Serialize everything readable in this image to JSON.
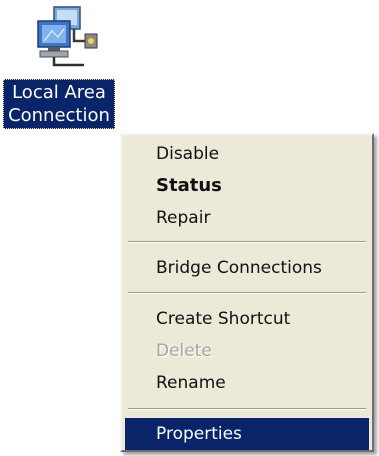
{
  "desktop_icon": {
    "label_line1": "Local Area",
    "label_line2": "Connection",
    "icon": "network-connection-icon"
  },
  "context_menu": {
    "items": [
      {
        "label": "Disable",
        "state": "enabled"
      },
      {
        "label": "Status",
        "state": "default"
      },
      {
        "label": "Repair",
        "state": "enabled"
      },
      {
        "label": "Bridge Connections",
        "state": "enabled"
      },
      {
        "label": "Create Shortcut",
        "state": "enabled"
      },
      {
        "label": "Delete",
        "state": "disabled"
      },
      {
        "label": "Rename",
        "state": "enabled"
      },
      {
        "label": "Properties",
        "state": "highlighted"
      }
    ]
  },
  "colors": {
    "selection": "#0a246a",
    "menu_background": "#ece9d8"
  }
}
